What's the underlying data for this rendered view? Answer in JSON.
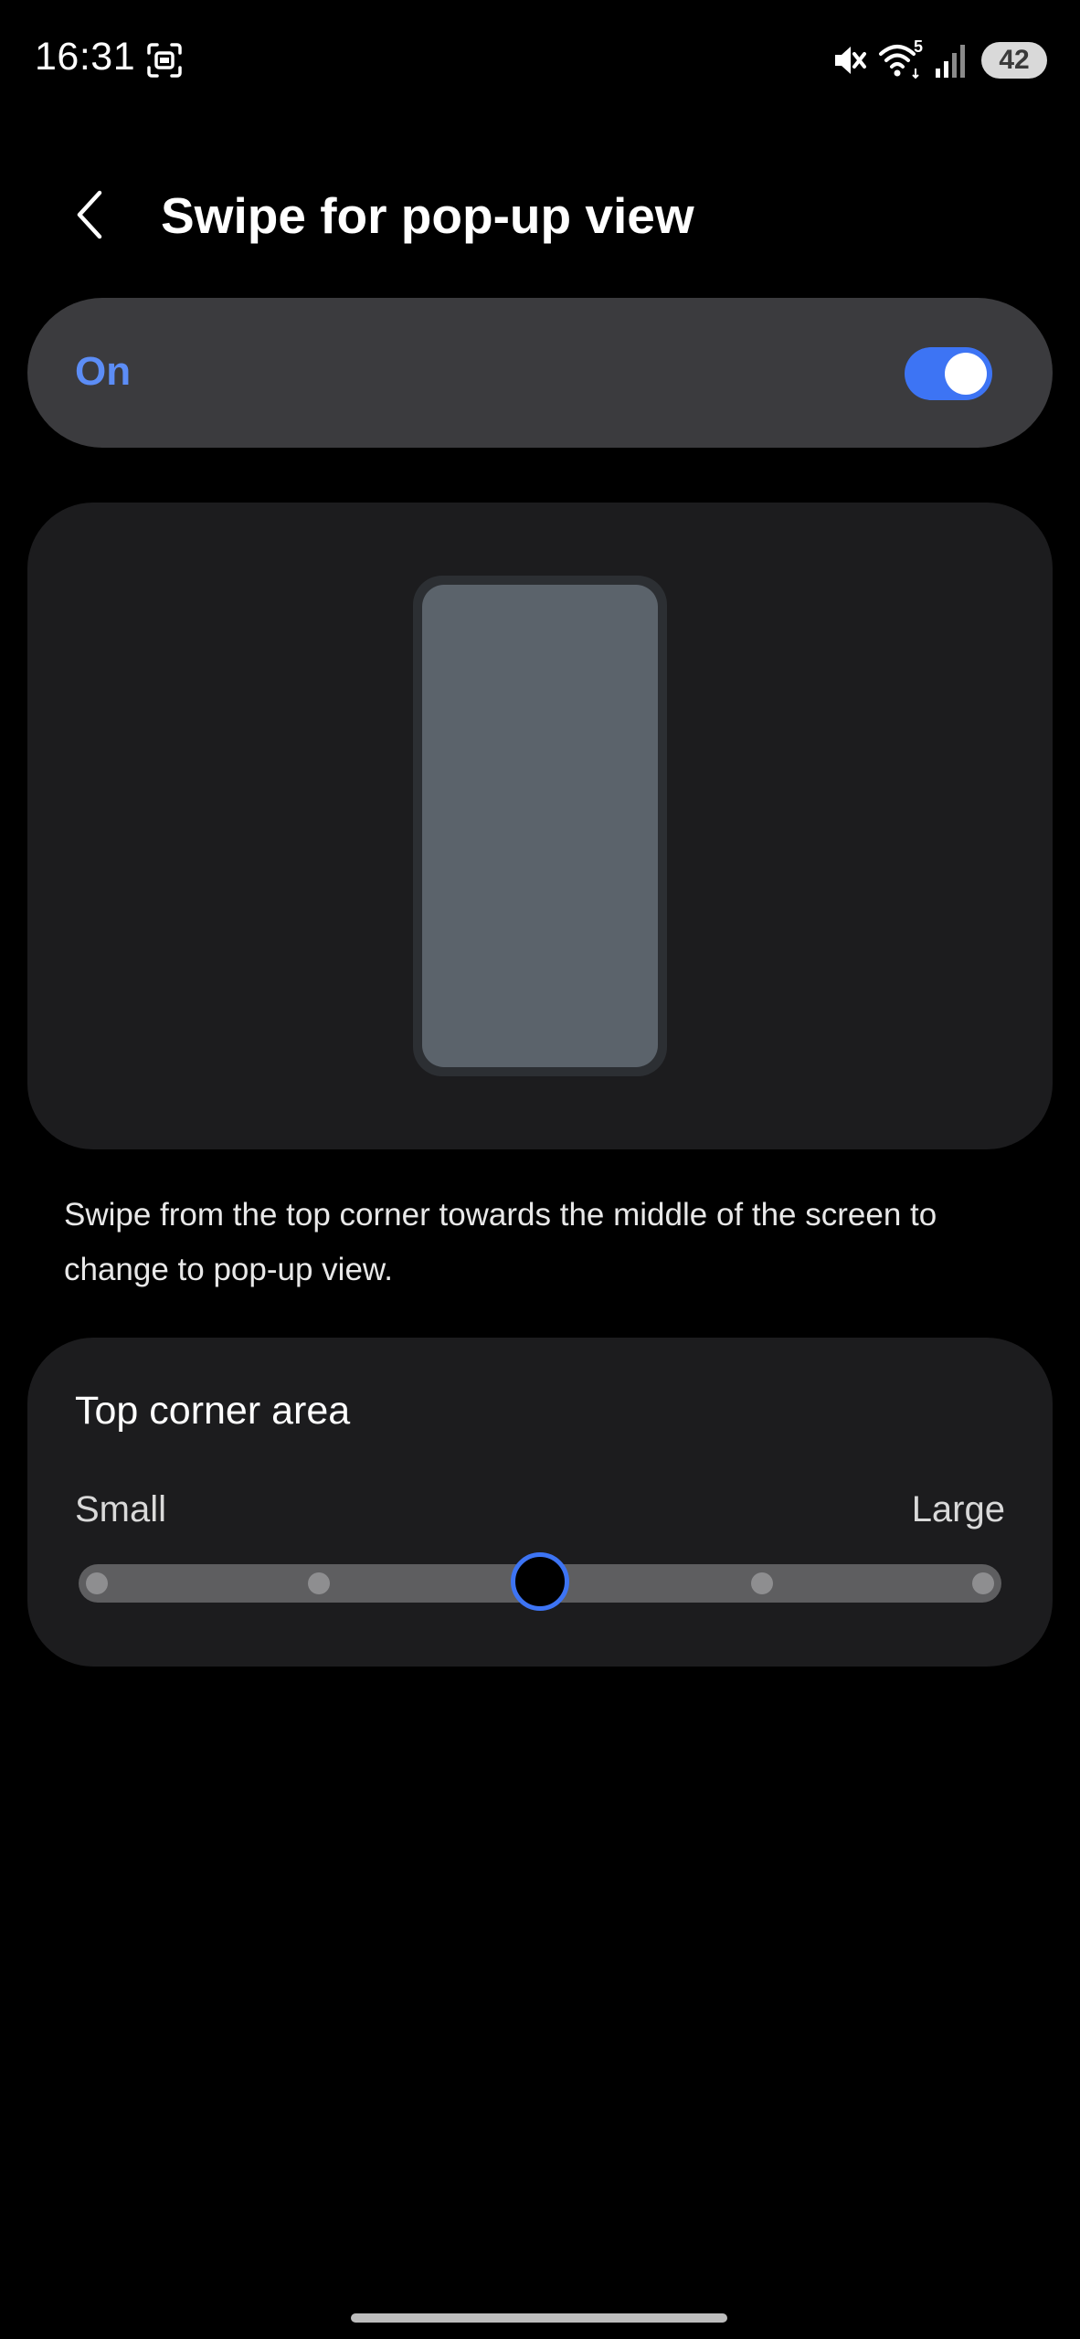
{
  "status_bar": {
    "time": "16:31",
    "icons": [
      "screenshot-icon",
      "mute-icon",
      "wifi-icon",
      "signal-icon"
    ],
    "wifi_badge": "5",
    "battery": "42"
  },
  "header": {
    "title": "Swipe for pop-up view",
    "back_icon": "chevron-left-icon"
  },
  "master_switch": {
    "label": "On",
    "state": true,
    "accent_color": "#3d74f4"
  },
  "description": "Swipe from the top corner towards the middle of the screen to change to pop-up view.",
  "corner_area": {
    "title": "Top corner area",
    "min_label": "Small",
    "max_label": "Large",
    "steps": 5,
    "selected_step": 3
  }
}
